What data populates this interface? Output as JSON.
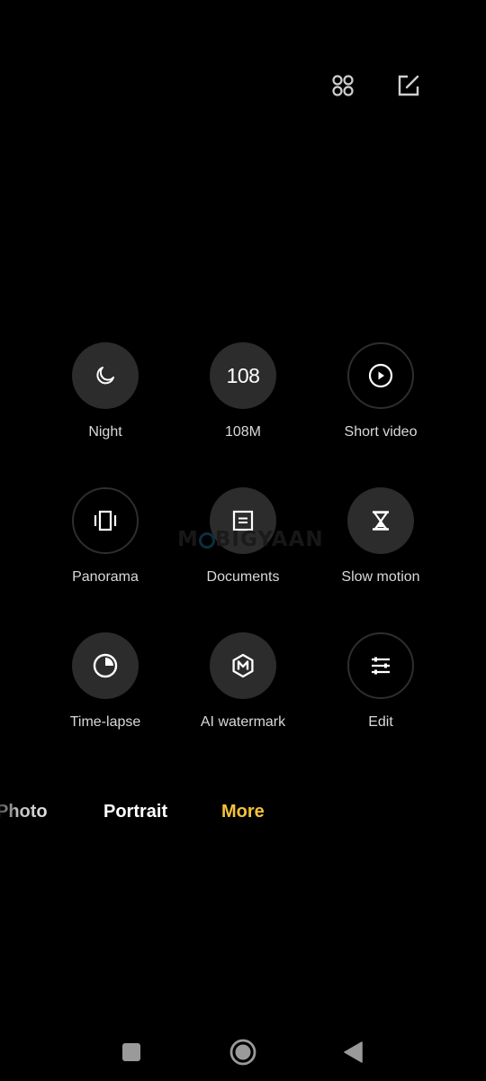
{
  "top_bar": {
    "icons": [
      {
        "name": "grid-layout-icon"
      },
      {
        "name": "edit-icon"
      }
    ]
  },
  "modes": [
    {
      "label": "Night",
      "icon": "moon-icon",
      "style": "filled"
    },
    {
      "label": "108M",
      "icon": "108-text",
      "icon_text": "108",
      "style": "filled"
    },
    {
      "label": "Short video",
      "icon": "play-circle-icon",
      "style": "outlined"
    },
    {
      "label": "Panorama",
      "icon": "panorama-icon",
      "style": "outlined"
    },
    {
      "label": "Documents",
      "icon": "document-icon",
      "style": "filled"
    },
    {
      "label": "Slow motion",
      "icon": "hourglass-icon",
      "style": "filled"
    },
    {
      "label": "Time-lapse",
      "icon": "timer-icon",
      "style": "filled"
    },
    {
      "label": "AI watermark",
      "icon": "hexagon-m-icon",
      "style": "filled"
    },
    {
      "label": "Edit",
      "icon": "sliders-icon",
      "style": "outlined"
    }
  ],
  "watermark": {
    "text_left": "M",
    "text_right": "BIGYAAN"
  },
  "mode_tabs": [
    {
      "label": "Photo",
      "active": false
    },
    {
      "label": "Portrait",
      "active": false
    },
    {
      "label": "More",
      "active": true
    }
  ],
  "colors": {
    "accent": "#f2c23c",
    "background": "#000000",
    "circle_fill": "#2c2c2c"
  },
  "nav_bar": {
    "buttons": [
      {
        "name": "recents"
      },
      {
        "name": "home"
      },
      {
        "name": "back"
      }
    ]
  }
}
